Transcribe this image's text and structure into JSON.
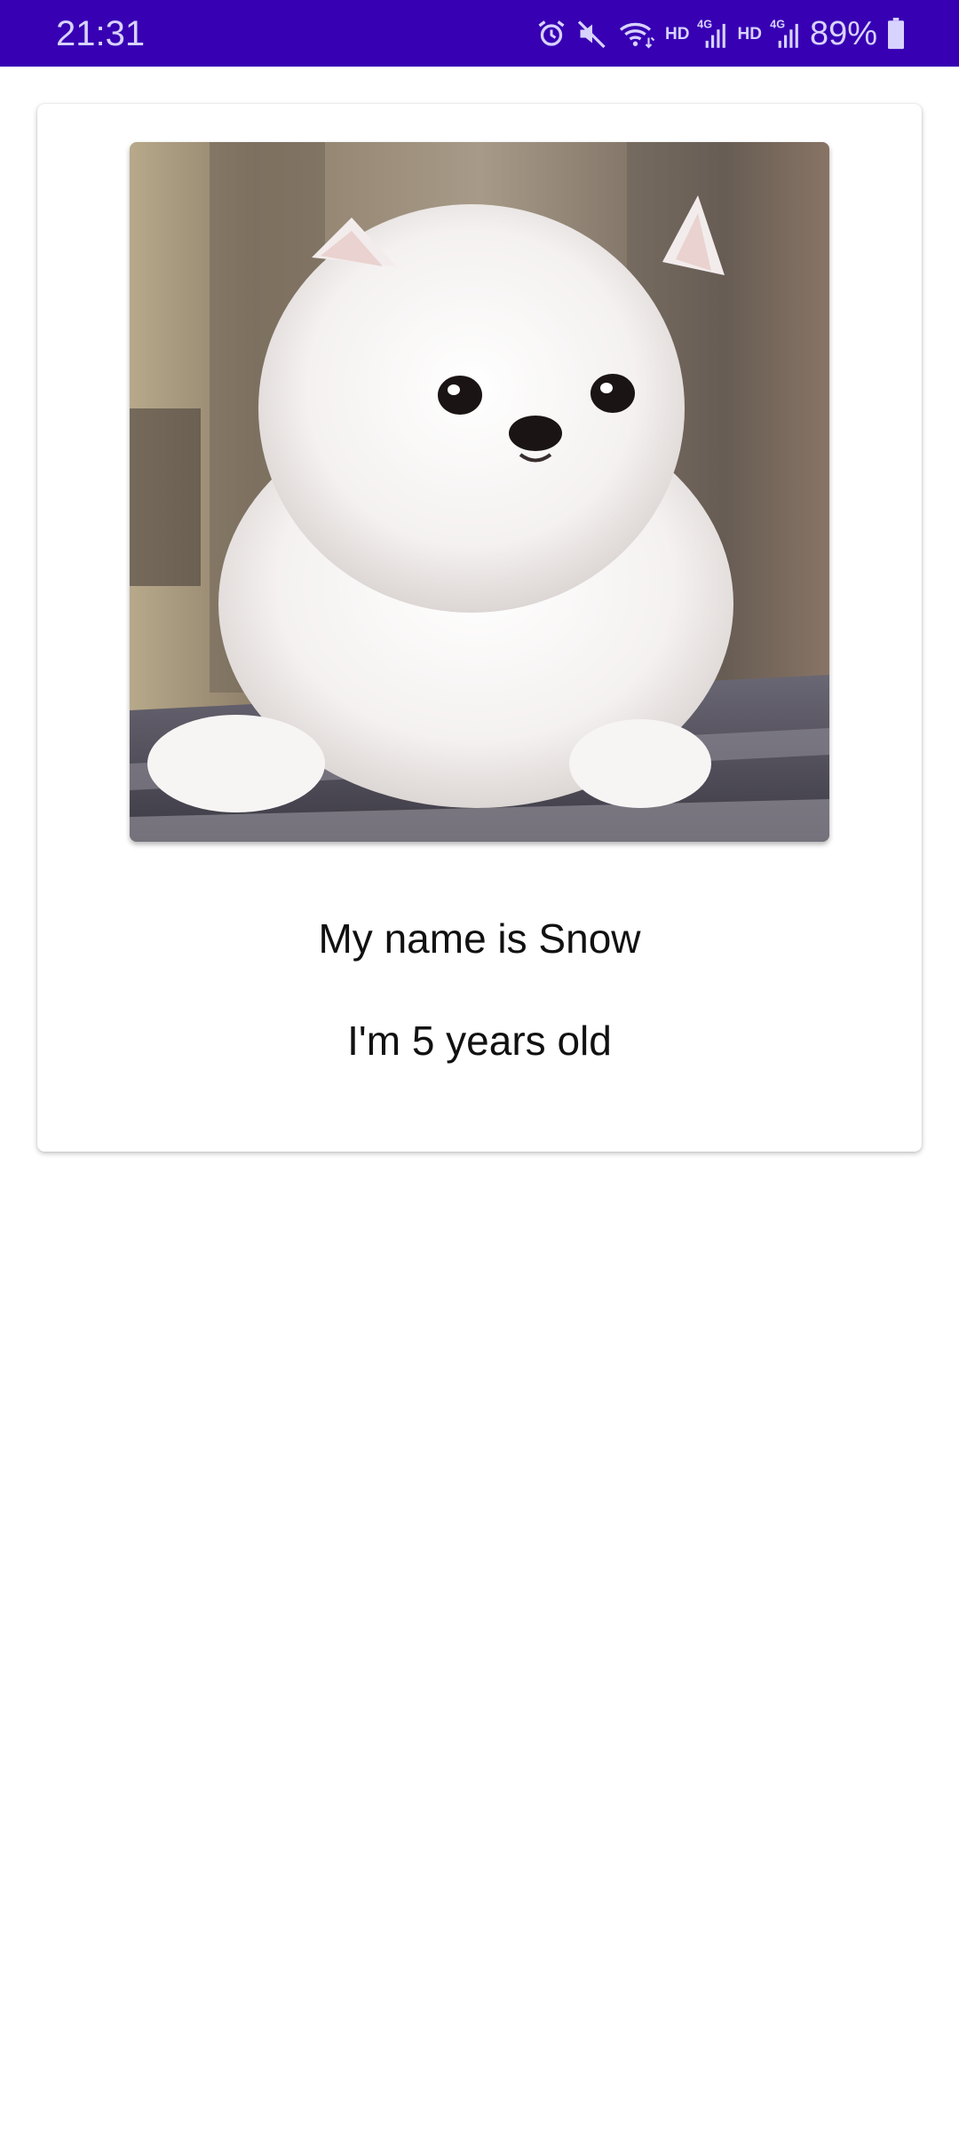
{
  "status_bar": {
    "time": "21:31",
    "icons": [
      "alarm-icon",
      "mute-icon",
      "wifi-icon",
      "signal-icon",
      "signal-icon",
      "battery-icon"
    ],
    "hd_label_1": "HD",
    "hd_label_2": "HD",
    "network_1": "4G",
    "network_2": "4G",
    "battery": "89%",
    "background_color": "#3700b3"
  },
  "card": {
    "name_text": "My name is Snow",
    "age_text": "I'm 5 years old"
  }
}
